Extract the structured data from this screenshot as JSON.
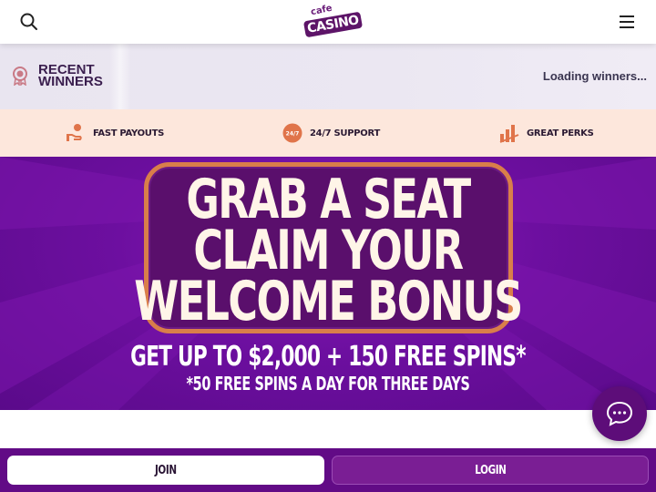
{
  "header": {
    "search_icon": "search-icon",
    "menu_icon": "hamburger-menu-icon",
    "logo_top": "cafe",
    "logo_main": "CASINO"
  },
  "recent_winners": {
    "title_line1": "RECENT",
    "title_line2": "WINNERS",
    "status": "Loading winners..."
  },
  "features": [
    {
      "icon": "hand-coin-icon",
      "label": "FAST PAYOUTS"
    },
    {
      "icon": "24-7-support-icon",
      "label": "24/7 SUPPORT"
    },
    {
      "icon": "bar-chart-icon",
      "label": "GREAT PERKS"
    }
  ],
  "features_icon_text": "24/7",
  "hero": {
    "line1": "GRAB A SEAT",
    "line2": "CLAIM YOUR",
    "line3": "WELCOME BONUS",
    "offer": "GET UP TO $2,000 + 150 FREE SPINS*",
    "sub": "*50 FREE SPINS A DAY FOR THREE DAYS"
  },
  "actions": {
    "join_label": "JOIN",
    "login_label": "LOGIN"
  },
  "chat": {
    "icon": "chat-bubble-icon"
  },
  "colors": {
    "brand_purple": "#620b86",
    "accent_orange": "#d97e4a",
    "features_bg": "#fde7dc"
  }
}
